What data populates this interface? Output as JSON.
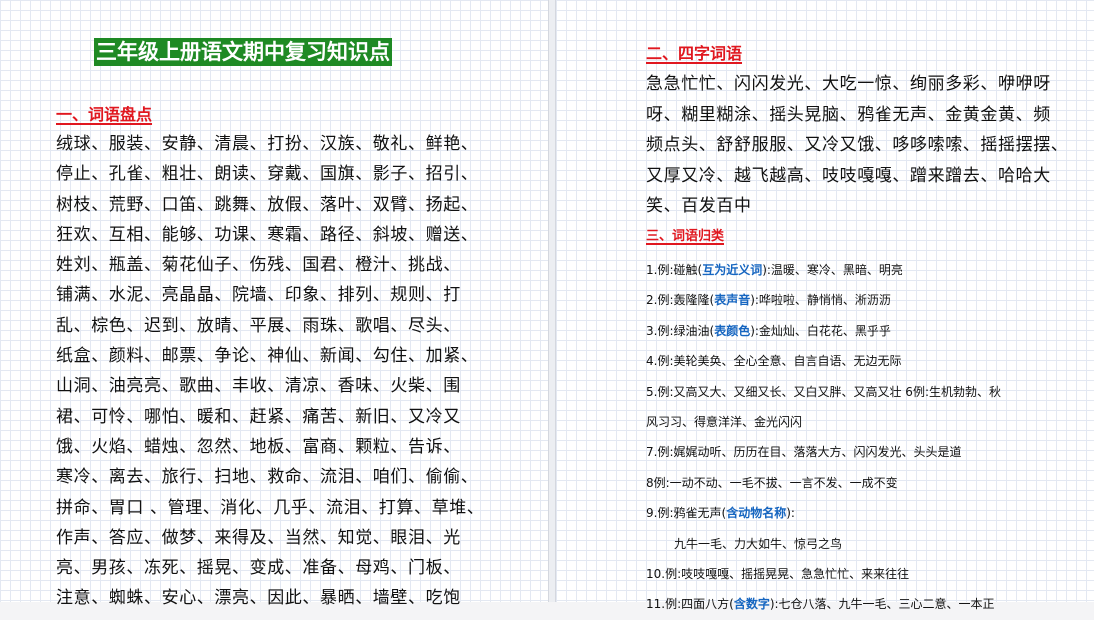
{
  "left": {
    "title": "三年级上册语文期中复习知识点",
    "section1": "一、词语盘点",
    "vocab_lines": [
      "绒球、服装、安静、清晨、打扮、汉族、敬礼、鲜艳、",
      "停止、孔雀、粗壮、朗读、穿戴、国旗、影子、招引、",
      "树枝、荒野、口笛、跳舞、放假、落叶、双臂、扬起、",
      "狂欢、互相、能够、功课、寒霜、路径、斜坡、赠送、",
      "姓刘、瓶盖、菊花仙子、伤残、国君、橙汁、挑战、",
      "铺满、水泥、亮晶晶、院墙、印象、排列、规则、打",
      "乱、棕色、迟到、放晴、平展、雨珠、歌唱、尽头、",
      "纸盒、颜料、邮票、争论、神仙、新闻、勾住、加紧、",
      "山洞、油亮亮、歌曲、丰收、清凉、香味、火柴、围",
      "裙、可怜、哪怕、暖和、赶紧、痛苦、新旧、又冷又",
      "饿、火焰、蜡烛、忽然、地板、富商、颗粒、告诉、",
      "寒冷、离去、旅行、扫地、救命、流泪、咱们、偷偷、",
      "拼命、胃口 、管理、消化、几乎、流泪、打算、草堆、",
      "作声、答应、做梦、来得及、当然、知觉、眼泪、光",
      "亮、男孩、冻死、摇晃、变成、准备、母鸡、门板、",
      "注意、蜘蛛、安心、漂亮、因此、暴晒、墙壁、吃饱"
    ]
  },
  "right": {
    "section2": "二、四字词语",
    "four_lines": [
      "急急忙忙、闪闪发光、大吃一惊、绚丽多彩、咿咿呀",
      "呀、糊里糊涂、摇头晃脑、鸦雀无声、金黄金黄、频",
      "频点头、舒舒服服、又冷又饿、哆哆嗦嗦、摇摇摆摆、",
      "又厚又冷、越飞越高、吱吱嘎嘎、蹭来蹭去、哈哈大",
      "笑、百发百中"
    ],
    "section3": "三、词语归类",
    "cats": {
      "c1_pre": "1.例:碰触(",
      "c1_hl": "互为近义词",
      "c1_post": "):温暖、寒冷、黑暗、明亮",
      "c2_pre": "2.例:轰隆隆(",
      "c2_hl": "表声音",
      "c2_post": "):哗啦啦、静悄悄、淅沥沥",
      "c3_pre": "3.例:绿油油(",
      "c3_hl": "表颜色",
      "c3_post": "):金灿灿、白花花、黑乎乎",
      "c4": "4.例:美轮美奂、全心全意、自言自语、无边无际",
      "c5a": "5.例:又高又大、又细又长、又白又胖、又高又壮 6例:生机勃勃、秋",
      "c5b": "风习习、得意洋洋、金光闪闪",
      "c7": "7.例:娓娓动听、历历在目、落落大方、闪闪发光、头头是道",
      "c8": "8例:一动不动、一毛不拔、一言不发、一成不变",
      "c9_pre": "9.例:鸦雀无声(",
      "c9_hl": "含动物名称",
      "c9_post": "):",
      "c9b": "九牛一毛、力大如牛、惊弓之鸟",
      "c10": "10.例:吱吱嘎嘎、摇摇晃晃、急急忙忙、来来往往",
      "c11_pre": "11.例:四面八方(",
      "c11_hl": "含数字",
      "c11_post": "):七仓八落、九牛一毛、三心二意、一本正"
    }
  }
}
